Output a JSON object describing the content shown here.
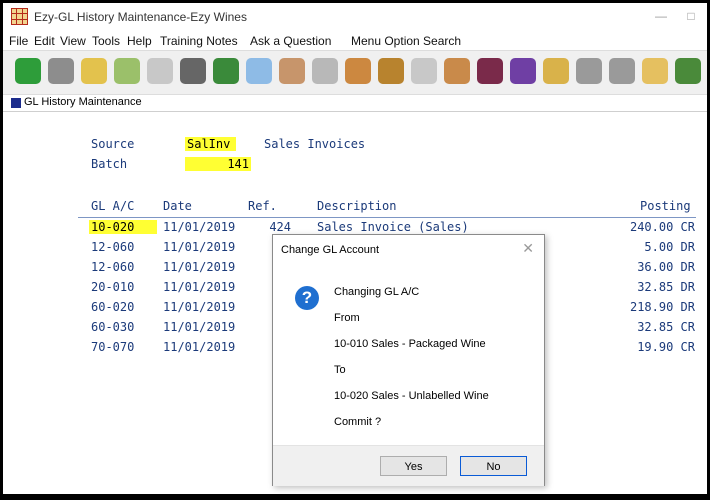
{
  "window": {
    "title": "Ezy-GL History Maintenance-Ezy Wines",
    "minimize": "—",
    "maximize": "□"
  },
  "menu": [
    "File",
    "Edit",
    "View",
    "Tools",
    "Help",
    "Training Notes",
    "Ask a Question",
    "Menu Option Search"
  ],
  "toolbar_icons": [
    {
      "name": "back-arrow-icon",
      "color": "#2e9d3a"
    },
    {
      "name": "forward-arrow-icon",
      "color": "#8d8d8d"
    },
    {
      "name": "folder-icon",
      "color": "#e3c24d"
    },
    {
      "name": "edit-icon",
      "color": "#9bc06a"
    },
    {
      "name": "brush-icon",
      "color": "#c8c8c8"
    },
    {
      "name": "building-icon",
      "color": "#666666"
    },
    {
      "name": "money-icon",
      "color": "#3a8a3a"
    },
    {
      "name": "card-icon",
      "color": "#8ebbe6"
    },
    {
      "name": "users-icon",
      "color": "#c7956b"
    },
    {
      "name": "wrench-icon",
      "color": "#b8b8b8"
    },
    {
      "name": "barrel-icon",
      "color": "#cc8840"
    },
    {
      "name": "shopping-icon",
      "color": "#b8832e"
    },
    {
      "name": "glass-icon",
      "color": "#c8c8c8"
    },
    {
      "name": "person-icon",
      "color": "#c98a4a"
    },
    {
      "name": "bottle-icon",
      "color": "#7a2a4a"
    },
    {
      "name": "grapes-icon",
      "color": "#6f3fa4"
    },
    {
      "name": "crate-icon",
      "color": "#d9b24a"
    },
    {
      "name": "gear-icon",
      "color": "#9a9a9a"
    },
    {
      "name": "cylinder-icon",
      "color": "#9a9a9a"
    },
    {
      "name": "box-icon",
      "color": "#e5c060"
    },
    {
      "name": "leaf-icon",
      "color": "#4a8a3a"
    },
    {
      "name": "dollar-icon",
      "color": "#3f9d3f"
    }
  ],
  "subheader": "GL History Maintenance",
  "form": {
    "source_label": "Source",
    "source_value": "SalInv",
    "source_desc": "Sales Invoices",
    "batch_label": "Batch",
    "batch_value": "141"
  },
  "table": {
    "headers": {
      "account": "GL A/C",
      "date": "Date",
      "ref": "Ref.",
      "description": "Description",
      "posting": "Posting"
    },
    "rows": [
      {
        "account": "10-020",
        "date": "11/01/2019",
        "ref": "424",
        "description": "Sales Invoice (Sales)",
        "posting": "240.00 CR"
      },
      {
        "account": "12-060",
        "date": "11/01/2019",
        "ref": "",
        "description": "",
        "posting": "5.00 DR"
      },
      {
        "account": "12-060",
        "date": "11/01/2019",
        "ref": "",
        "description": "",
        "posting": "36.00 DR"
      },
      {
        "account": "20-010",
        "date": "11/01/2019",
        "ref": "",
        "description": "",
        "posting": "32.85 DR"
      },
      {
        "account": "60-020",
        "date": "11/01/2019",
        "ref": "",
        "description": "",
        "posting": "218.90 DR"
      },
      {
        "account": "60-030",
        "date": "11/01/2019",
        "ref": "",
        "description": "",
        "posting": "32.85 CR"
      },
      {
        "account": "70-070",
        "date": "11/01/2019",
        "ref": "",
        "description": "",
        "posting": "19.90 CR"
      }
    ]
  },
  "dialog": {
    "title": "Change GL Account",
    "close": "✕",
    "icon": "question-icon",
    "lines": {
      "heading": "Changing GL A/C",
      "from_label": "From",
      "from_value": "10-010   Sales - Packaged Wine",
      "to_label": "To",
      "to_value": "10-020   Sales - Unlabelled Wine",
      "commit": "Commit ?"
    },
    "yes_label": "Yes",
    "no_label": "No"
  }
}
